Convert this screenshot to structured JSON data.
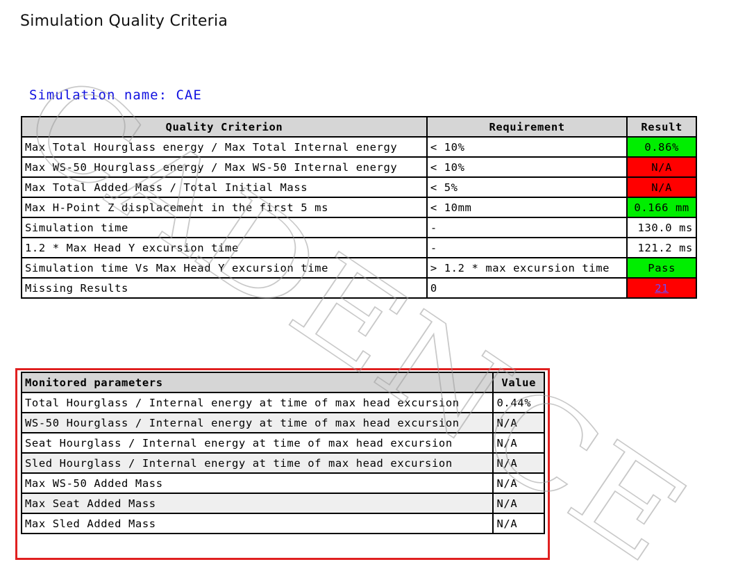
{
  "page": {
    "title": "Simulation Quality Criteria",
    "simulation_name": "Simulation name: CAE"
  },
  "watermark": {
    "text": "CADENCE"
  },
  "criteria": {
    "headers": [
      "Quality Criterion",
      "Requirement",
      "Result"
    ],
    "rows": [
      {
        "criterion": "Max Total Hourglass energy / Max Total Internal energy",
        "requirement": "< 10%",
        "result": "0.86%",
        "status": "green"
      },
      {
        "criterion": "Max WS-50 Hourglass energy / Max WS-50 Internal energy",
        "requirement": "< 10%",
        "result": "N/A",
        "status": "red"
      },
      {
        "criterion": "Max Total Added Mass / Total Initial Mass",
        "requirement": "< 5%",
        "result": "N/A",
        "status": "red"
      },
      {
        "criterion": "Max H-Point Z displacement in the first 5 ms",
        "requirement": "< 10mm",
        "result": "0.166 mm",
        "status": "green"
      },
      {
        "criterion": "Simulation time",
        "requirement": "-",
        "result": "130.0 ms",
        "status": "none"
      },
      {
        "criterion": "1.2 * Max Head Y excursion time",
        "requirement": "-",
        "result": "121.2 ms",
        "status": "none"
      },
      {
        "criterion": "Simulation time Vs Max Head Y excursion time",
        "requirement": "> 1.2 * max excursion time",
        "result": "Pass",
        "status": "green"
      },
      {
        "criterion": "Missing Results",
        "requirement": "0",
        "result": "21",
        "status": "red"
      }
    ]
  },
  "monitored": {
    "headers": [
      "Monitored parameters",
      "Value"
    ],
    "rows": [
      {
        "parameter": "Total Hourglass / Internal energy at time of max head excursion",
        "value": "0.44%"
      },
      {
        "parameter": "WS-50 Hourglass / Internal energy at time of max head excursion",
        "value": "N/A"
      },
      {
        "parameter": "Seat Hourglass / Internal energy at time of max head excursion",
        "value": "N/A"
      },
      {
        "parameter": "Sled Hourglass / Internal energy at time of max head excursion",
        "value": "N/A"
      },
      {
        "parameter": "Max WS-50 Added Mass",
        "value": "N/A"
      },
      {
        "parameter": "Max Seat Added Mass",
        "value": "N/A"
      },
      {
        "parameter": "Max Sled Added Mass",
        "value": "N/A"
      }
    ]
  },
  "colors": {
    "pass": "#00ee00",
    "fail": "#ff0000",
    "header_bg": "#d6d6d6",
    "simulation_name": "#1010e0",
    "highlight_frame": "#e02020"
  }
}
